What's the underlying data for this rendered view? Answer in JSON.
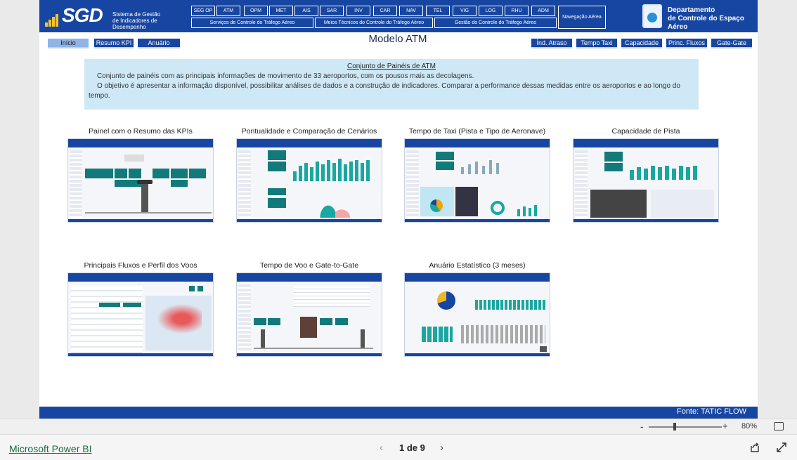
{
  "header": {
    "logo_text": "SGD",
    "logo_sub_1": "Sistema de Gestão",
    "logo_sub_2": "de Indicadores de Desempenho",
    "nav_top": [
      "SEG OP",
      "ATM",
      "OPM",
      "MET",
      "AIS",
      "SAR",
      "INV",
      "CAR",
      "NAV",
      "TEL",
      "VIG",
      "LOG",
      "RHU",
      "ADM"
    ],
    "nav_groups": [
      "Serviços de Controle do Tráfego Aéreo",
      "Meios Técnicos do Controle do Tráfego Aéreo",
      "Gestão do Controle do Tráfego Aéreo"
    ],
    "nav_aerea": "Navegação Aérea",
    "decea_1": "Departamento",
    "decea_2": "de Controle do Espaço Aéreo"
  },
  "tabs_left": [
    "Início",
    "Resumo KPI",
    "Anuário"
  ],
  "tabs_right": [
    "Índ. Atraso",
    "Tempo Taxi",
    "Capacidade",
    "Princ. Fluxos",
    "Gate-Gate"
  ],
  "page_title": "Modelo ATM",
  "info": {
    "heading": "Conjunto de Painéis de ATM",
    "line1": "Conjunto de painéis com as principais informações de movimento de 33 aeroportos, com os pousos mais as decolagens.",
    "line2": "O objetivo é apresentar a informação disponível, possibilitar análises de dados e a construção de indicadores. Comparar a performance dessas medidas entre os aeroportos e ao longo do tempo."
  },
  "cards": [
    {
      "title": "Painel com o Resumo das KPIs"
    },
    {
      "title": "Pontualidade e Comparação de Cenários"
    },
    {
      "title": "Tempo de Taxi (Pista e Tipo de Aeronave)"
    },
    {
      "title": "Capacidade de Pista"
    },
    {
      "title": "Principais Fluxos e Perfil dos Voos"
    },
    {
      "title": "Tempo de Voo e Gate-to-Gate"
    },
    {
      "title": "Anuário Estatístico (3 meses)"
    }
  ],
  "footer_source": "Fonte: TATIC FLOW",
  "zoom": {
    "minus": "-",
    "plus": "+",
    "level": "80%"
  },
  "bottom": {
    "brand": "Microsoft Power BI",
    "page_label": "1 de 9",
    "prev": "‹",
    "next": "›"
  },
  "colors": {
    "brand_blue": "#1746a2",
    "info_bg": "#cfe8f6",
    "teal": "#127a7a"
  }
}
